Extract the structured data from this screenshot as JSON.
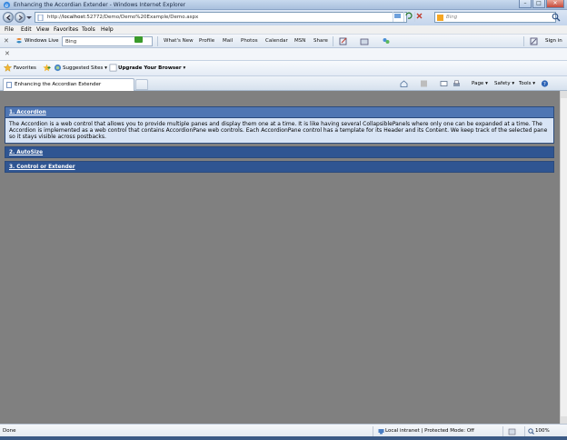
{
  "window": {
    "title": "Enhancing the Accordian Extender - Windows Internet Explorer",
    "controls": {
      "minimize": "–",
      "maximize": "□",
      "close": "✕"
    }
  },
  "address": {
    "url_prefix": "http://",
    "url_host": "localhost",
    "url_rest": ":52772/Demo/Demo%20Example/Demo.aspx",
    "search_placeholder": "Bing"
  },
  "menu": {
    "items": [
      "File",
      "Edit",
      "View",
      "Favorites",
      "Tools",
      "Help"
    ]
  },
  "live_toolbar": {
    "brand": "Windows Live",
    "search_value": "Bing",
    "links": [
      "What's New",
      "Profile",
      "Mail",
      "Photos",
      "Calendar",
      "MSN",
      "Share"
    ],
    "sign_in": "Sign in"
  },
  "favorites_bar": {
    "favorites": "Favorites",
    "suggested": "Suggested Sites ▾",
    "upgrade": "Upgrade Your Browser ▾"
  },
  "tabs": [
    {
      "label": "Enhancing the Accordian Extender"
    }
  ],
  "command_bar": {
    "page": "Page ▾",
    "safety": "Safety ▾",
    "tools": "Tools ▾"
  },
  "accordion": {
    "panes": [
      {
        "header": "1. Accordion",
        "content": "The Accordion is a web control that allows you to provide multiple panes and display them one at a time. It is like having several CollapsiblePanels where only one can be expanded at a time. The Accordion is implemented as a web control that contains AccordionPane web controls. Each AccordionPane control has a template for its Header and its Content. We keep track of the selected pane so it stays visible across postbacks.",
        "selected": true
      },
      {
        "header": "2. AutoSize",
        "selected": false
      },
      {
        "header": "3. Control or Extender",
        "selected": false
      }
    ]
  },
  "status": {
    "text": "Done",
    "zone": "Local intranet | Protected Mode: Off",
    "zoom": "100%"
  },
  "colors": {
    "page_background": "#808080",
    "accordion_header": "#2f5592",
    "accordion_header_selected": "#4f76b3",
    "accordion_content": "#d8e4f5"
  }
}
